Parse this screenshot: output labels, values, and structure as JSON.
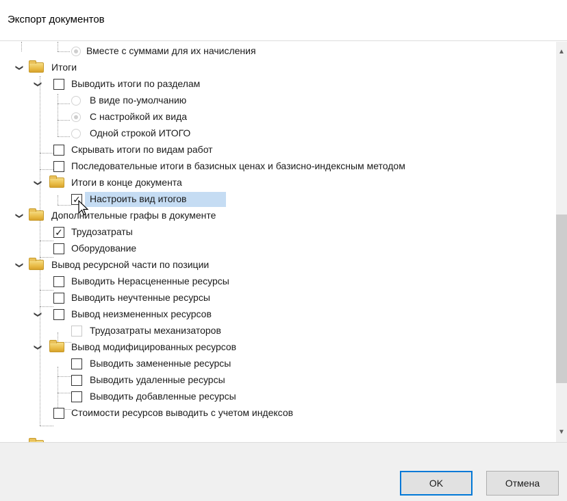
{
  "window": {
    "title": "Экспорт документов"
  },
  "tree": {
    "items": [
      {
        "label": "Вместе с суммами для их начисления"
      },
      {
        "label": "Итоги"
      },
      {
        "label": "Выводить итоги по разделам"
      },
      {
        "label": "В виде по-умолчанию"
      },
      {
        "label": "С настройкой их вида"
      },
      {
        "label": "Одной строкой ИТОГО"
      },
      {
        "label": "Скрывать итоги по видам работ"
      },
      {
        "label": "Последовательные итоги в базисных ценах и базисно-индексным методом"
      },
      {
        "label": "Итоги в конце документа"
      },
      {
        "label": "Настроить вид итогов"
      },
      {
        "label": "Дополнительные графы в документе"
      },
      {
        "label": "Трудозатраты"
      },
      {
        "label": "Оборудование"
      },
      {
        "label": "Вывод ресурсной части по позиции"
      },
      {
        "label": "Выводить Нерасцененные ресурсы"
      },
      {
        "label": "Выводить неучтенные ресурсы"
      },
      {
        "label": "Вывод неизмененных ресурсов"
      },
      {
        "label": "Трудозатраты механизаторов"
      },
      {
        "label": "Вывод модифицированных ресурсов"
      },
      {
        "label": "Выводить замененные ресурсы"
      },
      {
        "label": "Выводить удаленные ресурсы"
      },
      {
        "label": "Выводить добавленные ресурсы"
      },
      {
        "label": "Стоимости ресурсов выводить с учетом индексов"
      }
    ],
    "check_mark": "✓",
    "expand_glyph": "❯"
  },
  "scrollbar": {
    "up_glyph": "▲",
    "down_glyph": "▼"
  },
  "buttons": {
    "ok": "OK",
    "cancel": "Отмена"
  },
  "colors": {
    "selection": "#c5dcf3",
    "folder": "#e9bd48",
    "accent": "#0078d7"
  }
}
